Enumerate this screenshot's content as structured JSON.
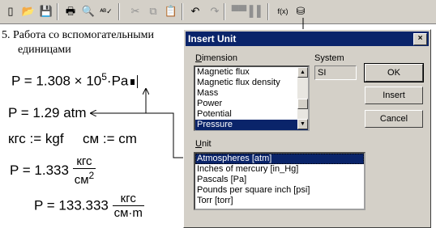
{
  "toolbar": {
    "buttons": [
      {
        "name": "new-document-icon",
        "glyph": "▯"
      },
      {
        "name": "open-folder-icon",
        "glyph": "📂"
      },
      {
        "name": "save-icon",
        "glyph": "💾"
      },
      {
        "name": "print-icon",
        "glyph": "🖶"
      },
      {
        "name": "print-preview-icon",
        "glyph": "🔍"
      },
      {
        "name": "spell-check-icon",
        "glyph": "ᴬᴮ✓"
      },
      {
        "name": "cut-icon",
        "glyph": "✂"
      },
      {
        "name": "copy-icon",
        "glyph": "⧉"
      },
      {
        "name": "paste-icon",
        "glyph": "📋"
      },
      {
        "name": "undo-icon",
        "glyph": "↶"
      },
      {
        "name": "redo-icon",
        "glyph": "↷"
      },
      {
        "name": "align-across-icon",
        "glyph": "▀▀"
      },
      {
        "name": "align-down-icon",
        "glyph": "▌▌"
      },
      {
        "name": "insert-function-icon",
        "glyph": "f(x)"
      },
      {
        "name": "insert-unit-icon",
        "glyph": "⛁"
      }
    ]
  },
  "worksheet": {
    "heading_line1": "5. Работа со вспомогательными",
    "heading_line2": "единицами",
    "eq1": {
      "lhs": "P = 1.308 × 10",
      "exp": "5",
      "rhs": "·Pa"
    },
    "eq2": "P = 1.29 atm",
    "eq3a": "кгс := kgf",
    "eq3b": "см := cm",
    "eq4": {
      "lhs": "P = 1.333",
      "num": "кгс",
      "den": "см",
      "den_exp": "2"
    },
    "eq5": {
      "lhs": "P = 133.333",
      "num": "кгс",
      "den": "см·m"
    }
  },
  "dialog": {
    "title": "Insert Unit",
    "close_glyph": "×",
    "dimension_label": "Dimension",
    "dimension_items": [
      "Magnetic flux",
      "Magnetic flux density",
      "Mass",
      "Power",
      "Potential",
      "Pressure"
    ],
    "dimension_selected": "Pressure",
    "system_label": "System",
    "system_value": "SI",
    "unit_label": "Unit",
    "unit_items": [
      "Atmospheres [atm]",
      "Inches of mercury [in_Hg]",
      "Pascals [Pa]",
      "Pounds per square inch [psi]",
      "Torr [torr]"
    ],
    "unit_selected": "Atmospheres [atm]",
    "buttons": {
      "ok": "OK",
      "insert": "Insert",
      "cancel": "Cancel"
    }
  },
  "colors": {
    "selection": "#0a246a",
    "face": "#d4d0c8",
    "title_bar": "#0a246a"
  }
}
